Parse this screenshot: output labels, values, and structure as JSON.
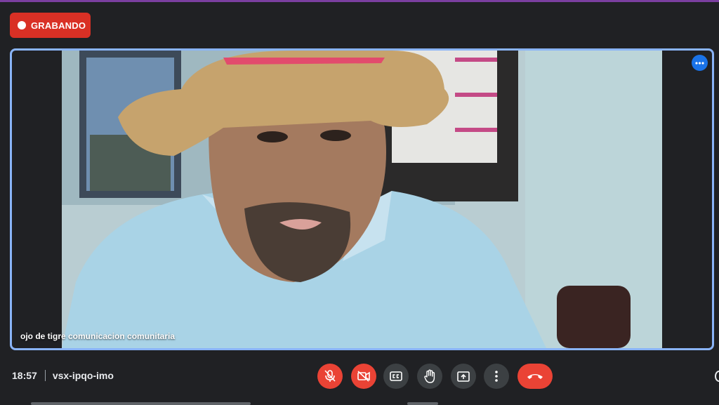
{
  "recording": {
    "label": "GRABANDO"
  },
  "participant": {
    "name": "ojo de tigre comunicacion comunitaria"
  },
  "meeting": {
    "time": "18:57",
    "code": "vsx-ipqo-imo"
  },
  "controls": [
    {
      "name": "mic-off",
      "icon": "mic-off-icon",
      "state": "off"
    },
    {
      "name": "camera-off",
      "icon": "videocam-off-icon",
      "state": "off"
    },
    {
      "name": "captions",
      "icon": "closed-caption-icon"
    },
    {
      "name": "raise-hand",
      "icon": "hand-icon"
    },
    {
      "name": "present",
      "icon": "present-screen-icon"
    },
    {
      "name": "more-options",
      "icon": "more-vert-icon"
    },
    {
      "name": "leave-call",
      "icon": "call-end-icon"
    }
  ],
  "colors": {
    "recording": "#d93025",
    "danger": "#ea4335",
    "active_border": "#8ab4f8",
    "accent": "#1a73e8"
  }
}
